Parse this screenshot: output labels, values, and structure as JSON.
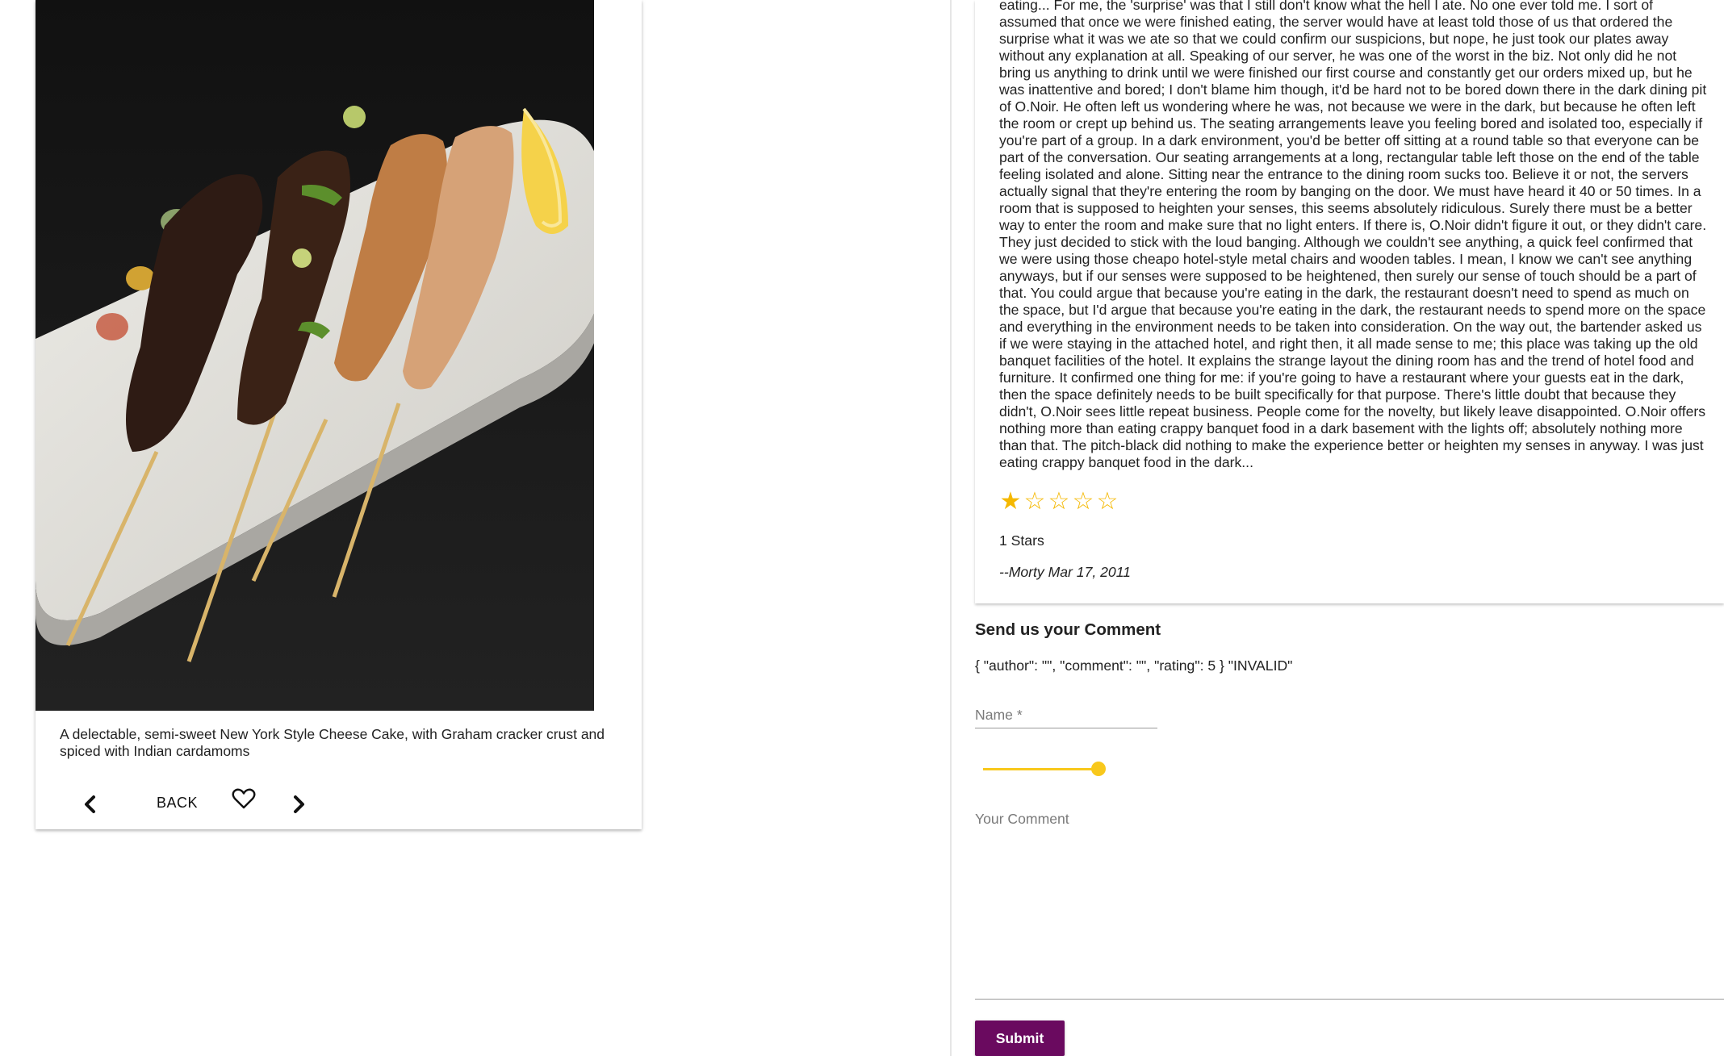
{
  "dish": {
    "image_alt": "Grilled meat skewers on a white plate",
    "description": "A delectable, semi-sweet New York Style Cheese Cake, with Graham cracker crust and spiced with Indian cardamoms",
    "actions": {
      "prev_icon": "chevron-left-icon",
      "back_label": "BACK",
      "favorite_icon": "heart-outline-icon",
      "next_icon": "chevron-right-icon"
    }
  },
  "review": {
    "text": "eating... For me, the 'surprise' was that I still don't know what the hell I ate. No one ever told me. I sort of assumed that once we were finished eating, the server would have at least told those of us that ordered the surprise what it was we ate so that we could confirm our suspicions, but nope, he just took our plates away without any explanation at all. Speaking of our server, he was one of the worst in the biz. Not only did he not bring us anything to drink until we were finished our first course and constantly get our orders mixed up, but he was inattentive and bored; I don't blame him though, it'd be hard not to be bored down there in the dark dining pit of O.Noir. He often left us wondering where he was, not because we were in the dark, but because he often left the room or crept up behind us. The seating arrangements leave you feeling bored and isolated too, especially if you're part of a group. In a dark environment, you'd be better off sitting at a round table so that everyone can be part of the conversation. Our seating arrangements at a long, rectangular table left those on the end of the table feeling isolated and alone. Sitting near the entrance to the dining room sucks too. Believe it or not, the servers actually signal that they're entering the room by banging on the door. We must have heard it 40 or 50 times. In a room that is supposed to heighten your senses, this seems absolutely ridiculous. Surely there must be a better way to enter the room and make sure that no light enters. If there is, O.Noir didn't figure it out, or they didn't care. They just decided to stick with the loud banging. Although we couldn't see anything, a quick feel confirmed that we were using those cheapo hotel-style metal chairs and wooden tables. I mean, I know we can't see anything anyways, but if our senses were supposed to be heightened, then surely our sense of touch should be a part of that. You could argue that because you're eating in the dark, the restaurant doesn't need to spend as much on the space, but I'd argue that because you're eating in the dark, the restaurant needs to spend more on the space and everything in the environment needs to be taken into consideration. On the way out, the bartender asked us if we were staying in the attached hotel, and right then, it all made sense to me; this place was taking up the old banquet facilities of the hotel. It explains the strange layout the dining room has and the trend of hotel food and furniture. It confirmed one thing for me: if you're going to have a restaurant where your guests eat in the dark, then the space definitely needs to be built specifically for that purpose. There's little doubt that because they didn't, O.Noir sees little repeat business. People come for the novelty, but likely leave disappointed. O.Noir offers nothing more than eating crappy banquet food in a dark basement with the lights off; absolutely nothing more than that. The pitch-black did nothing to make the experience better or heighten my senses in anyway. I was just eating crappy banquet food in the dark...",
    "rating": 1,
    "max_rating": 5,
    "rating_text": "1 Stars",
    "author_line": "--Morty Mar 17, 2011",
    "star_color": "#f5b800"
  },
  "comment_form": {
    "title": "Send us your Comment",
    "state_display": "{ \"author\": \"\", \"comment\": \"\", \"rating\": 5 } \"INVALID\"",
    "name_value": "",
    "name_placeholder": "Name *",
    "rating_value": 5,
    "rating_max": 5,
    "comment_value": "",
    "comment_placeholder": "Your Comment",
    "submit_label": "Submit",
    "submit_color": "#6a0a5f",
    "slider_color": "#f8c81c"
  }
}
